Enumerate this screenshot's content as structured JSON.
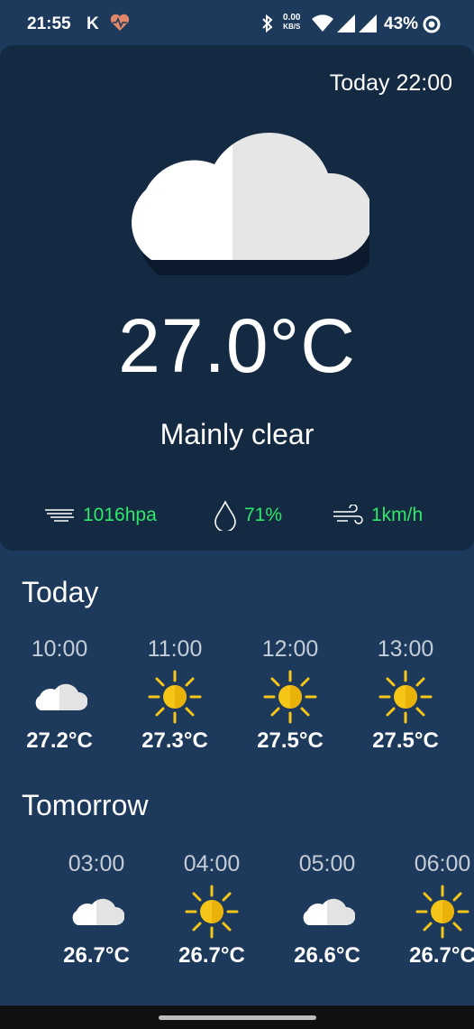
{
  "status_bar": {
    "time": "21:55",
    "k_label": "K",
    "net_speed_value": "0.00",
    "net_speed_unit": "KB/S",
    "battery": "43%",
    "icons": [
      "heart-monitor-icon",
      "bluetooth-icon",
      "wifi-icon",
      "signal-icon",
      "signal-icon",
      "data-saver-icon"
    ]
  },
  "current": {
    "forecast_time": "Today 22:00",
    "temperature": "27.0°C",
    "condition": "Mainly clear",
    "pressure": "1016hpa",
    "humidity": "71%",
    "wind": "1km/h",
    "icon": "cloud-icon"
  },
  "today": {
    "title": "Today",
    "hours": [
      {
        "time": "10:00",
        "temp": "27.2°C",
        "icon": "cloud"
      },
      {
        "time": "11:00",
        "temp": "27.3°C",
        "icon": "sun"
      },
      {
        "time": "12:00",
        "temp": "27.5°C",
        "icon": "sun"
      },
      {
        "time": "13:00",
        "temp": "27.5°C",
        "icon": "sun"
      }
    ]
  },
  "tomorrow": {
    "title": "Tomorrow",
    "hours": [
      {
        "time": "03:00",
        "temp": "26.7°C",
        "icon": "cloud"
      },
      {
        "time": "04:00",
        "temp": "26.7°C",
        "icon": "sun"
      },
      {
        "time": "05:00",
        "temp": "26.6°C",
        "icon": "cloud"
      },
      {
        "time": "06:00",
        "temp": "26.7°C",
        "icon": "sun"
      }
    ]
  },
  "colors": {
    "background": "#1d3a5c",
    "card": "#142942",
    "accent_green": "#2ee86a",
    "sun_yellow": "#f5c518"
  }
}
